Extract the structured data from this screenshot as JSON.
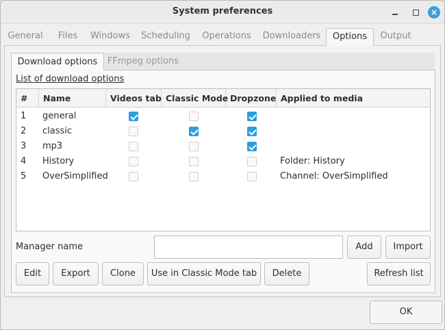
{
  "window": {
    "title": "System preferences",
    "controls": {
      "minimize": "minimize",
      "maximize": "maximize",
      "close": "×"
    }
  },
  "main_tabs": [
    "General",
    "Files",
    "Windows",
    "Scheduling",
    "Operations",
    "Downloaders",
    "Options",
    "Output"
  ],
  "main_tabs_active": "Options",
  "inner_tabs": [
    "Download options",
    "FFmpeg options"
  ],
  "inner_tabs_active": "Download options",
  "list_title": "List of download options",
  "table": {
    "headers": [
      "#",
      "Name",
      "Videos tab",
      "Classic Mode",
      "Dropzone",
      "Applied to media"
    ],
    "rows": [
      {
        "num": "1",
        "name": "general",
        "videos_tab": true,
        "classic_mode": false,
        "dropzone": true,
        "applied": ""
      },
      {
        "num": "2",
        "name": "classic",
        "videos_tab": false,
        "classic_mode": true,
        "dropzone": true,
        "applied": ""
      },
      {
        "num": "3",
        "name": "mp3",
        "videos_tab": false,
        "classic_mode": false,
        "dropzone": true,
        "applied": ""
      },
      {
        "num": "4",
        "name": "History",
        "videos_tab": false,
        "classic_mode": false,
        "dropzone": false,
        "applied": "Folder: History"
      },
      {
        "num": "5",
        "name": "OverSimplified",
        "videos_tab": false,
        "classic_mode": false,
        "dropzone": false,
        "applied": "Channel: OverSimplified"
      }
    ]
  },
  "manager": {
    "label": "Manager name",
    "value": "",
    "placeholder": ""
  },
  "buttons": {
    "add": "Add",
    "import": "Import",
    "edit": "Edit",
    "export": "Export",
    "clone": "Clone",
    "use_classic": "Use in Classic Mode tab",
    "delete": "Delete",
    "refresh": "Refresh list",
    "ok": "OK"
  },
  "colors": {
    "checkbox_on": "#2c9fdf",
    "close_button": "#3d9fd9"
  }
}
